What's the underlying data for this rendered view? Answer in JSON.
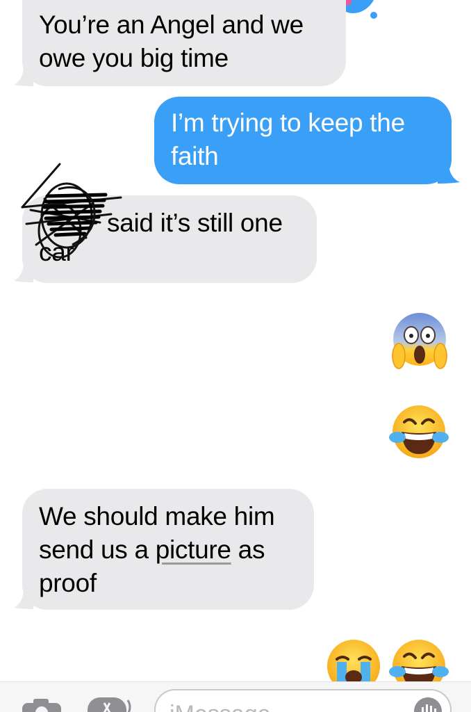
{
  "conversation": {
    "messages": [
      {
        "direction": "received",
        "text_lines": [
          "You’re an Angel and we",
          "owe you big time"
        ]
      },
      {
        "direction": "sent",
        "text_lines": [
          "I’m trying to keep the",
          "faith"
        ]
      },
      {
        "direction": "received",
        "text_lines": [
          "said it’s still one",
          "car"
        ]
      },
      {
        "direction": "sent",
        "emoji": "screaming-face"
      },
      {
        "direction": "sent",
        "emoji": "tears-of-joy-face"
      },
      {
        "direction": "received",
        "text_before": "We should make him",
        "text_mid_prefix": "send us a ",
        "text_link": "picture",
        "text_mid_suffix": " as",
        "text_after": "proof"
      },
      {
        "direction": "sent",
        "emoji": "crying-face"
      },
      {
        "direction": "sent",
        "emoji": "tears-of-joy-face"
      }
    ]
  },
  "input_bar": {
    "placeholder": "iMessage",
    "camera_icon": "camera-icon",
    "apps_icon": "app-store-icon",
    "mic_icon": "audio-waveform-icon"
  },
  "colors": {
    "received_bubble": "#e9e9eb",
    "sent_bubble": "#3a9ff7",
    "background": "#ffffff"
  }
}
